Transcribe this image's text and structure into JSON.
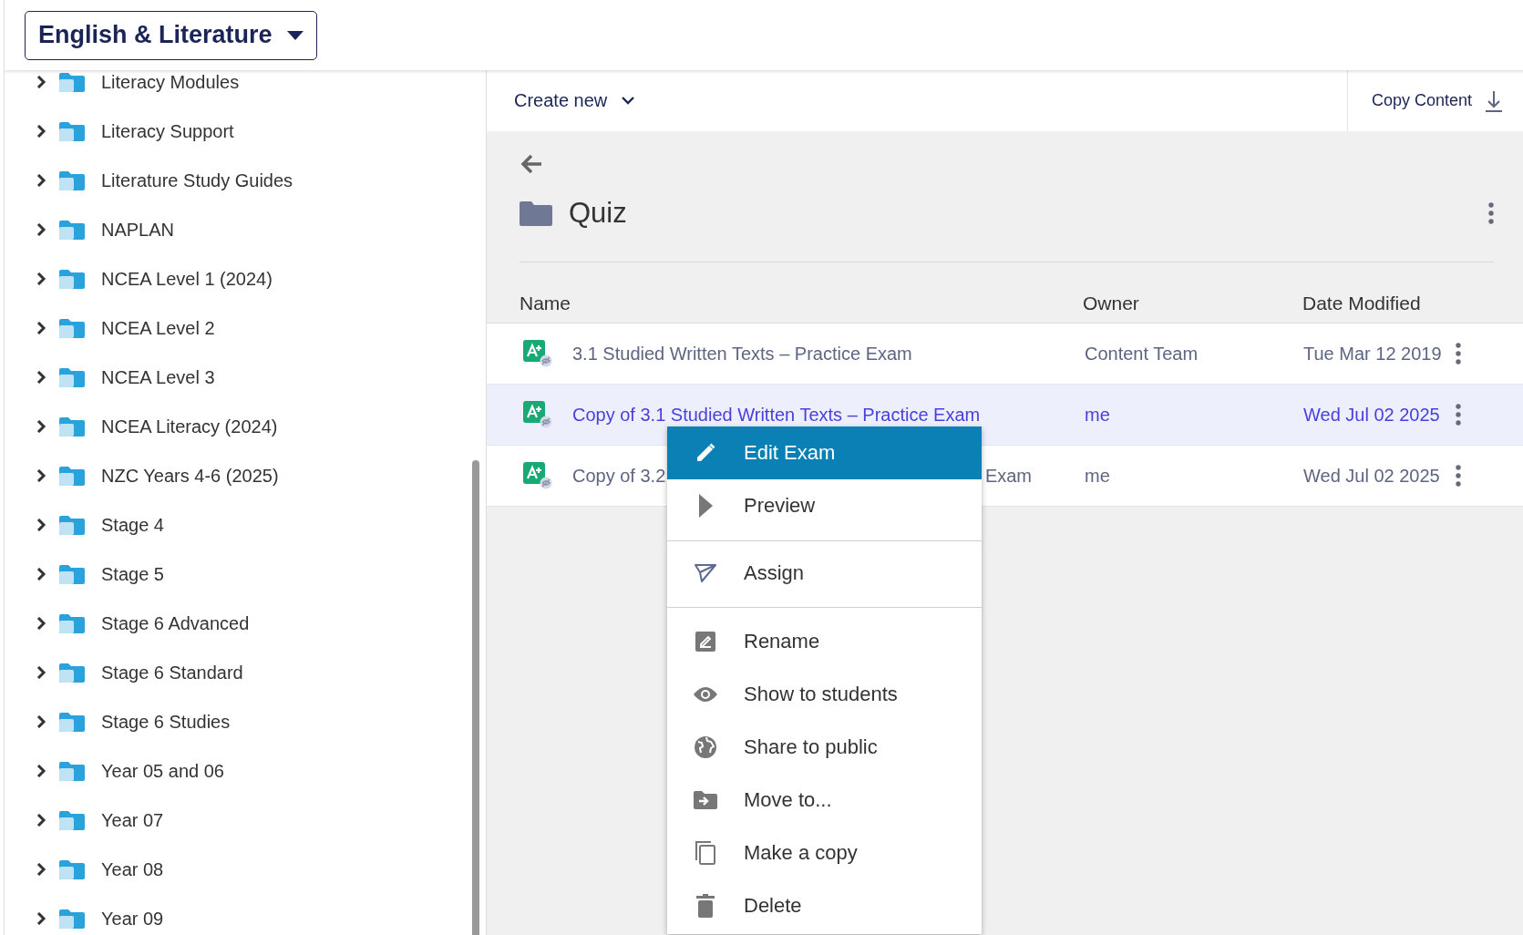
{
  "subject_selector": {
    "label": "English & Literature"
  },
  "sidebar": {
    "items": [
      {
        "label": "Literacy Modules",
        "expanded": false
      },
      {
        "label": "Literacy Support",
        "expanded": false
      },
      {
        "label": "Literature Study Guides",
        "expanded": false
      },
      {
        "label": "NAPLAN",
        "expanded": false
      },
      {
        "label": "NCEA Level 1 (2024)",
        "expanded": false
      },
      {
        "label": "NCEA Level 2",
        "expanded": false
      },
      {
        "label": "NCEA Level 3",
        "expanded": false
      },
      {
        "label": "NCEA Literacy (2024)",
        "expanded": false
      },
      {
        "label": "NZC Years 4-6 (2025)",
        "expanded": false
      },
      {
        "label": "Stage 4",
        "expanded": false
      },
      {
        "label": "Stage 5",
        "expanded": false
      },
      {
        "label": "Stage 6 Advanced",
        "expanded": false
      },
      {
        "label": "Stage 6 Standard",
        "expanded": false
      },
      {
        "label": "Stage 6 Studies",
        "expanded": false
      },
      {
        "label": "Year 05 and 06",
        "expanded": false
      },
      {
        "label": "Year 07",
        "expanded": false
      },
      {
        "label": "Year 08",
        "expanded": false
      },
      {
        "label": "Year 09",
        "expanded": false
      }
    ]
  },
  "toolbar": {
    "create_new": "Create new",
    "copy_content": "Copy Content"
  },
  "folder": {
    "title": "Quiz"
  },
  "table": {
    "columns": [
      "Name",
      "Owner",
      "Date Modified"
    ],
    "rows": [
      {
        "name": "3.1 Studied Written Texts – Practice Exam",
        "owner": "Content Team",
        "date": "Tue Mar 12 2019",
        "selected": false
      },
      {
        "name": "Copy of 3.1 Studied Written Texts – Practice Exam",
        "owner": "me",
        "date": "Wed Jul 02 2025",
        "selected": true
      },
      {
        "name": "Copy of 3.2",
        "name_after_menu": "Exam",
        "owner": "me",
        "date": "Wed Jul 02 2025",
        "selected": false
      }
    ]
  },
  "context_menu": {
    "groups": [
      [
        {
          "label": "Edit Exam",
          "selected": true
        },
        {
          "label": "Preview",
          "selected": false
        }
      ],
      [
        {
          "label": "Assign",
          "selected": false
        }
      ],
      [
        {
          "label": "Rename",
          "selected": false
        },
        {
          "label": "Show to students",
          "selected": false
        },
        {
          "label": "Share to public",
          "selected": false
        },
        {
          "label": "Move to...",
          "selected": false
        },
        {
          "label": "Make a copy",
          "selected": false
        },
        {
          "label": "Delete",
          "selected": false
        }
      ]
    ]
  }
}
